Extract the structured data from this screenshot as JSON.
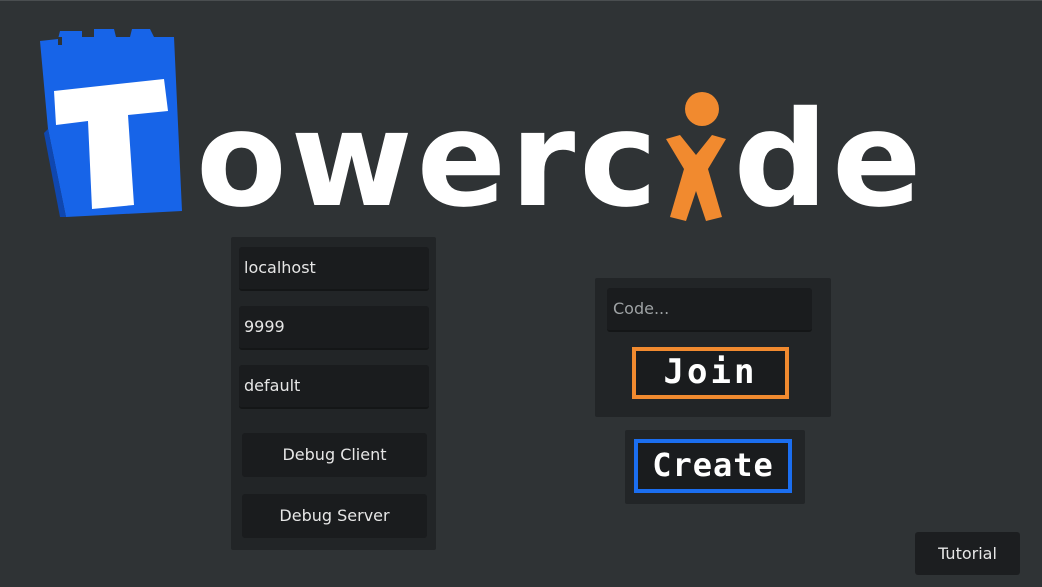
{
  "app": {
    "logo_text": "Towercide",
    "logo_text_left": "ower",
    "logo_text_mid": "c",
    "logo_text_right": "de"
  },
  "connection": {
    "host_value": "localhost",
    "port_value": "9999",
    "profile_value": "default",
    "debug_client_label": "Debug Client",
    "debug_server_label": "Debug Server"
  },
  "join": {
    "code_placeholder": "Code...",
    "join_label": "Join"
  },
  "create": {
    "create_label": "Create"
  },
  "footer": {
    "tutorial_label": "Tutorial"
  },
  "colors": {
    "background": "#2f3335",
    "panel": "#222527",
    "accent_orange": "#f18a2f",
    "accent_blue": "#1b6ef0"
  },
  "icons": {
    "logo_tower": "tower-icon",
    "logo_figure": "person-figure-icon"
  }
}
